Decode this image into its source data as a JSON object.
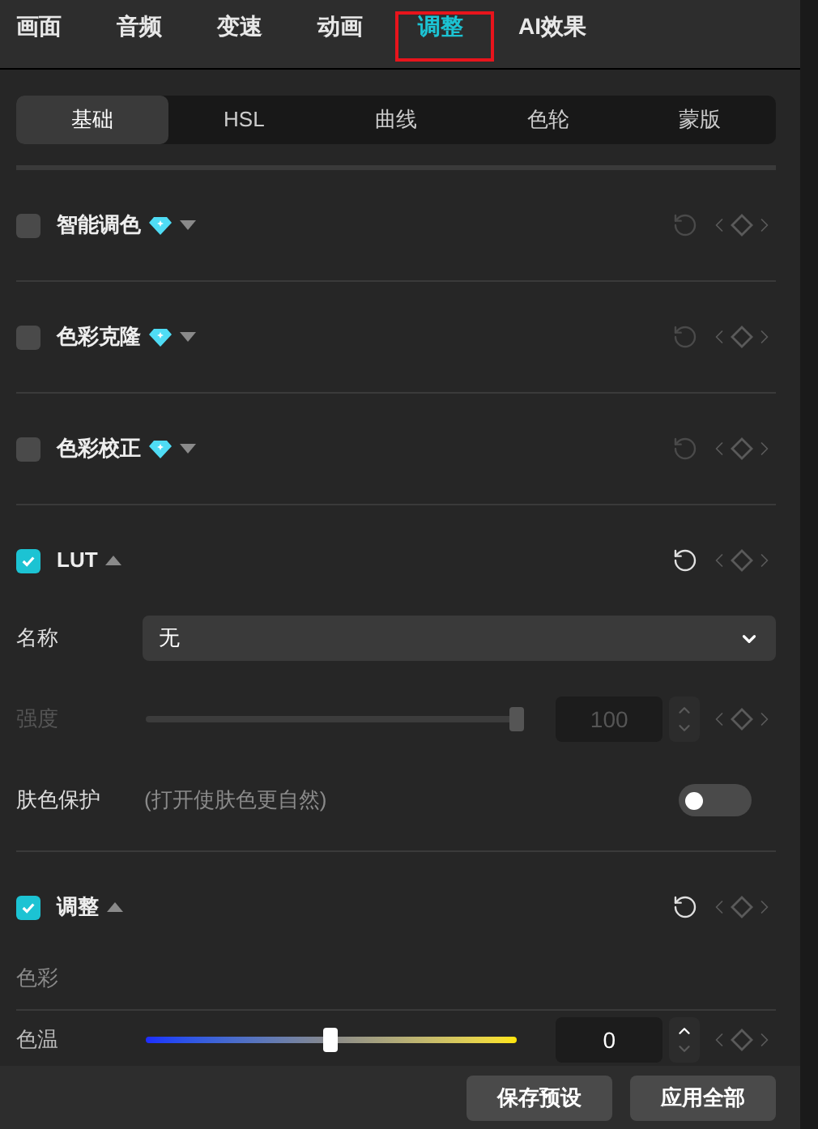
{
  "tabs": [
    {
      "label": "画面",
      "selected": false,
      "highlighted": false
    },
    {
      "label": "音频",
      "selected": false,
      "highlighted": false
    },
    {
      "label": "变速",
      "selected": false,
      "highlighted": false
    },
    {
      "label": "动画",
      "selected": false,
      "highlighted": false
    },
    {
      "label": "调整",
      "selected": true,
      "highlighted": true
    },
    {
      "label": "AI效果",
      "selected": false,
      "highlighted": false
    }
  ],
  "subtabs": [
    {
      "label": "基础",
      "selected": true
    },
    {
      "label": "HSL",
      "selected": false
    },
    {
      "label": "曲线",
      "selected": false
    },
    {
      "label": "色轮",
      "selected": false
    },
    {
      "label": "蒙版",
      "selected": false
    }
  ],
  "sections": [
    {
      "title": "智能调色",
      "checked": false,
      "premium": true,
      "expanded": false
    },
    {
      "title": "色彩克隆",
      "checked": false,
      "premium": true,
      "expanded": false
    },
    {
      "title": "色彩校正",
      "checked": false,
      "premium": true,
      "expanded": false
    },
    {
      "title": "LUT",
      "checked": true,
      "premium": false,
      "expanded": true,
      "rows": [
        {
          "kind": "select",
          "label": "名称",
          "value": "无"
        },
        {
          "kind": "slider",
          "label": "强度",
          "disabled": true,
          "level": 1,
          "value": "100"
        },
        {
          "kind": "toggle",
          "label": "肤色保护",
          "hint": "(打开使肤色更自然)",
          "on": false
        }
      ]
    },
    {
      "title": "调整",
      "checked": true,
      "premium": false,
      "expanded": true,
      "rows": [
        {
          "kind": "group",
          "label": "色彩"
        },
        {
          "kind": "gradient_slider",
          "label": "色温",
          "disabled": false,
          "level": 0.5,
          "value": "0"
        }
      ]
    }
  ],
  "footer_buttons": [
    "保存预设",
    "应用全部"
  ]
}
